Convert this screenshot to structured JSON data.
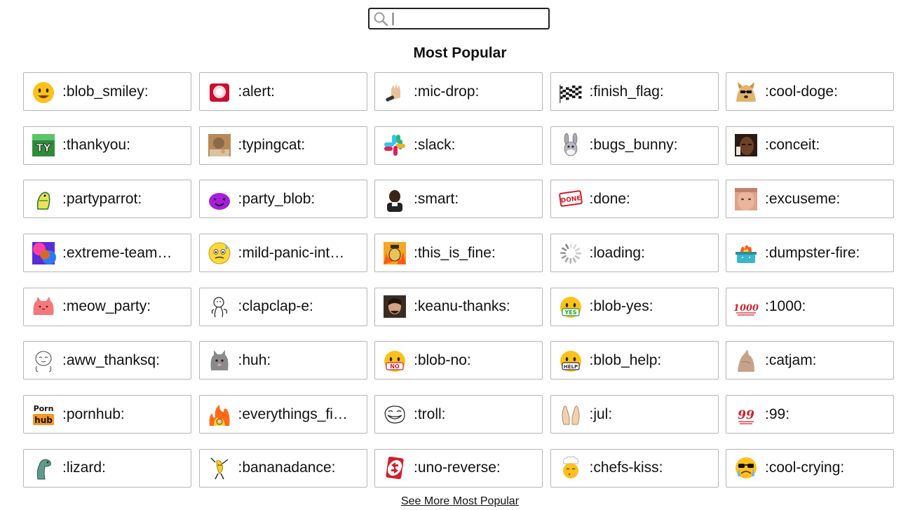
{
  "search": {
    "value": "",
    "placeholder": ""
  },
  "section_title": "Most Popular",
  "see_more_label": "See More Most Popular",
  "emojis": [
    {
      "name": ":blob_smiley:",
      "icon": "blob-smiley-icon"
    },
    {
      "name": ":alert:",
      "icon": "alert-icon"
    },
    {
      "name": ":mic-drop:",
      "icon": "mic-drop-icon"
    },
    {
      "name": ":finish_flag:",
      "icon": "finish-flag-icon"
    },
    {
      "name": ":cool-doge:",
      "icon": "cool-doge-icon"
    },
    {
      "name": ":thankyou:",
      "icon": "thankyou-icon"
    },
    {
      "name": ":typingcat:",
      "icon": "typingcat-icon"
    },
    {
      "name": ":slack:",
      "icon": "slack-icon"
    },
    {
      "name": ":bugs_bunny:",
      "icon": "bugs-bunny-icon"
    },
    {
      "name": ":conceit:",
      "icon": "conceit-icon"
    },
    {
      "name": ":partyparrot:",
      "icon": "partyparrot-icon"
    },
    {
      "name": ":party_blob:",
      "icon": "party-blob-icon"
    },
    {
      "name": ":smart:",
      "icon": "smart-icon"
    },
    {
      "name": ":done:",
      "icon": "done-stamp-icon"
    },
    {
      "name": ":excuseme:",
      "icon": "excuseme-icon"
    },
    {
      "name": ":extreme-team…",
      "icon": "extreme-teamwork-icon"
    },
    {
      "name": ":mild-panic-int…",
      "icon": "mild-panic-icon"
    },
    {
      "name": ":this_is_fine:",
      "icon": "this-is-fine-icon"
    },
    {
      "name": ":loading:",
      "icon": "loading-spinner-icon"
    },
    {
      "name": ":dumpster-fire:",
      "icon": "dumpster-fire-icon"
    },
    {
      "name": ":meow_party:",
      "icon": "meow-party-icon"
    },
    {
      "name": ":clapclap-e:",
      "icon": "clapclap-icon"
    },
    {
      "name": ":keanu-thanks:",
      "icon": "keanu-thanks-icon"
    },
    {
      "name": ":blob-yes:",
      "icon": "blob-yes-icon"
    },
    {
      "name": ":1000:",
      "icon": "1000-icon"
    },
    {
      "name": ":aww_thanksq:",
      "icon": "aww-thanks-icon"
    },
    {
      "name": ":huh:",
      "icon": "huh-cat-icon"
    },
    {
      "name": ":blob-no:",
      "icon": "blob-no-icon"
    },
    {
      "name": ":blob_help:",
      "icon": "blob-help-icon"
    },
    {
      "name": ":catjam:",
      "icon": "catjam-icon"
    },
    {
      "name": ":pornhub:",
      "icon": "pornhub-logo-icon"
    },
    {
      "name": ":everythings_fi…",
      "icon": "everythings-fine-icon"
    },
    {
      "name": ":troll:",
      "icon": "troll-face-icon"
    },
    {
      "name": ":jul:",
      "icon": "praying-hands-icon"
    },
    {
      "name": ":99:",
      "icon": "99-icon"
    },
    {
      "name": ":lizard:",
      "icon": "lizard-icon"
    },
    {
      "name": ":bananadance:",
      "icon": "bananadance-icon"
    },
    {
      "name": ":uno-reverse:",
      "icon": "uno-reverse-icon"
    },
    {
      "name": ":chefs-kiss:",
      "icon": "chefs-kiss-icon"
    },
    {
      "name": ":cool-crying:",
      "icon": "cool-crying-icon"
    }
  ],
  "icon_texts": {
    "thankyou": "TY",
    "done": "DONE",
    "yes": "YES",
    "no": "NO",
    "help": "HELP",
    "thousand": "1000",
    "ninety_nine": "99",
    "porn": "Porn",
    "hub": "hub"
  }
}
